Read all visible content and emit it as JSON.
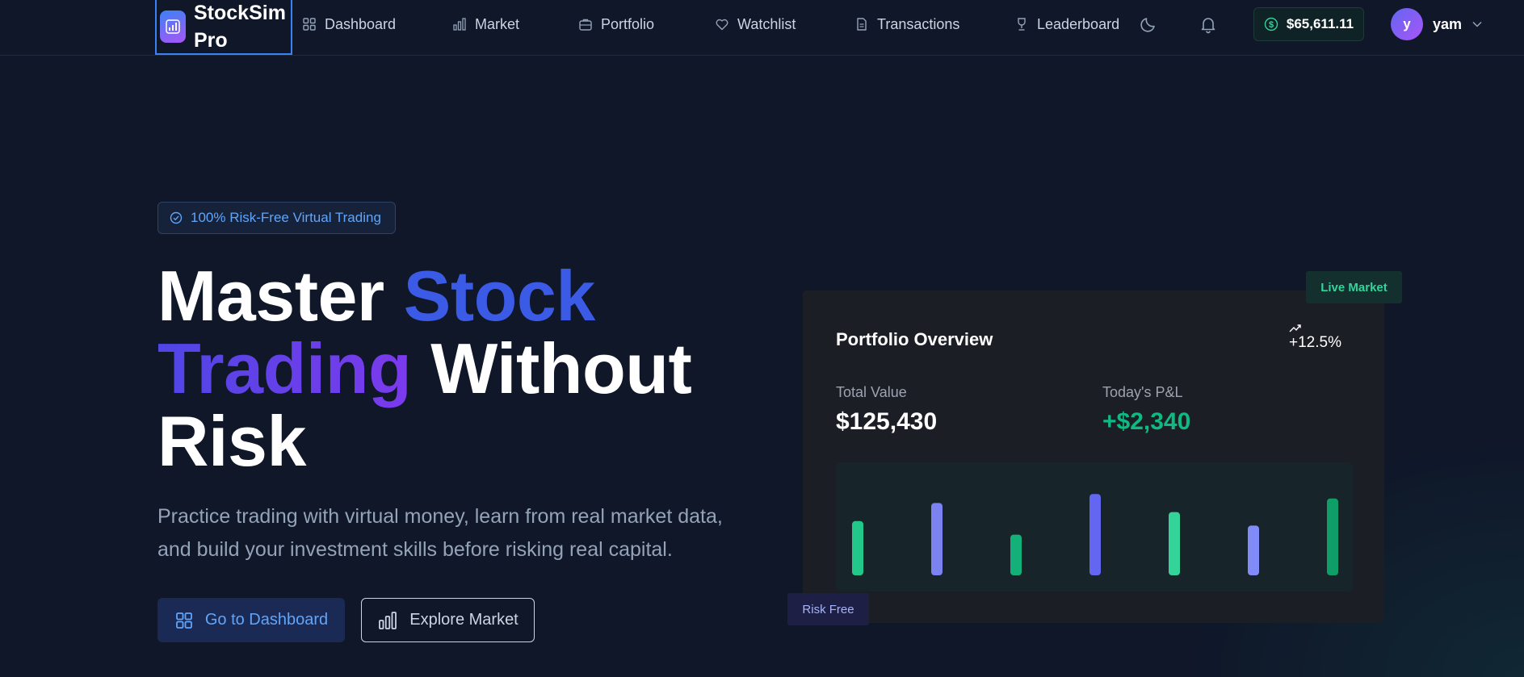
{
  "nav": {
    "brand": "StockSim Pro",
    "items": [
      {
        "label": "Dashboard",
        "icon": "grid-icon"
      },
      {
        "label": "Market",
        "icon": "bar-chart-icon"
      },
      {
        "label": "Portfolio",
        "icon": "briefcase-icon"
      },
      {
        "label": "Watchlist",
        "icon": "heart-icon"
      },
      {
        "label": "Transactions",
        "icon": "file-icon"
      },
      {
        "label": "Leaderboard",
        "icon": "trophy-icon"
      }
    ],
    "balance": "$65,611.11",
    "user": {
      "initial": "y",
      "name": "yam"
    }
  },
  "hero": {
    "badge": "100% Risk-Free Virtual Trading",
    "headline": {
      "part1": "Master ",
      "part2": "Stock",
      "part3": "Trading",
      "part4": " Without Risk"
    },
    "subtext": "Practice trading with virtual money, learn from real market data, and build your investment skills before risking real capital.",
    "primary_button": "Go to Dashboard",
    "secondary_button": "Explore Market"
  },
  "card": {
    "live_tag": "Live Market",
    "risk_tag": "Risk Free",
    "title": "Portfolio Overview",
    "change": "+12.5%",
    "total_value_label": "Total Value",
    "total_value": "$125,430",
    "pnl_label": "Today's P&L",
    "pnl": "+$2,340",
    "bars": [
      {
        "value": 60,
        "color": "#22c78a"
      },
      {
        "value": 80,
        "color": "#7c83f0"
      },
      {
        "value": 45,
        "color": "#14b07a"
      },
      {
        "value": 90,
        "color": "#6366f1"
      },
      {
        "value": 70,
        "color": "#34d399"
      },
      {
        "value": 55,
        "color": "#818cf8"
      },
      {
        "value": 85,
        "color": "#0f9d68"
      }
    ]
  },
  "colors": {
    "background": "#0f1729",
    "accent_blue": "#3b82f6",
    "accent_green": "#10b981",
    "accent_purple": "#6366f1"
  }
}
